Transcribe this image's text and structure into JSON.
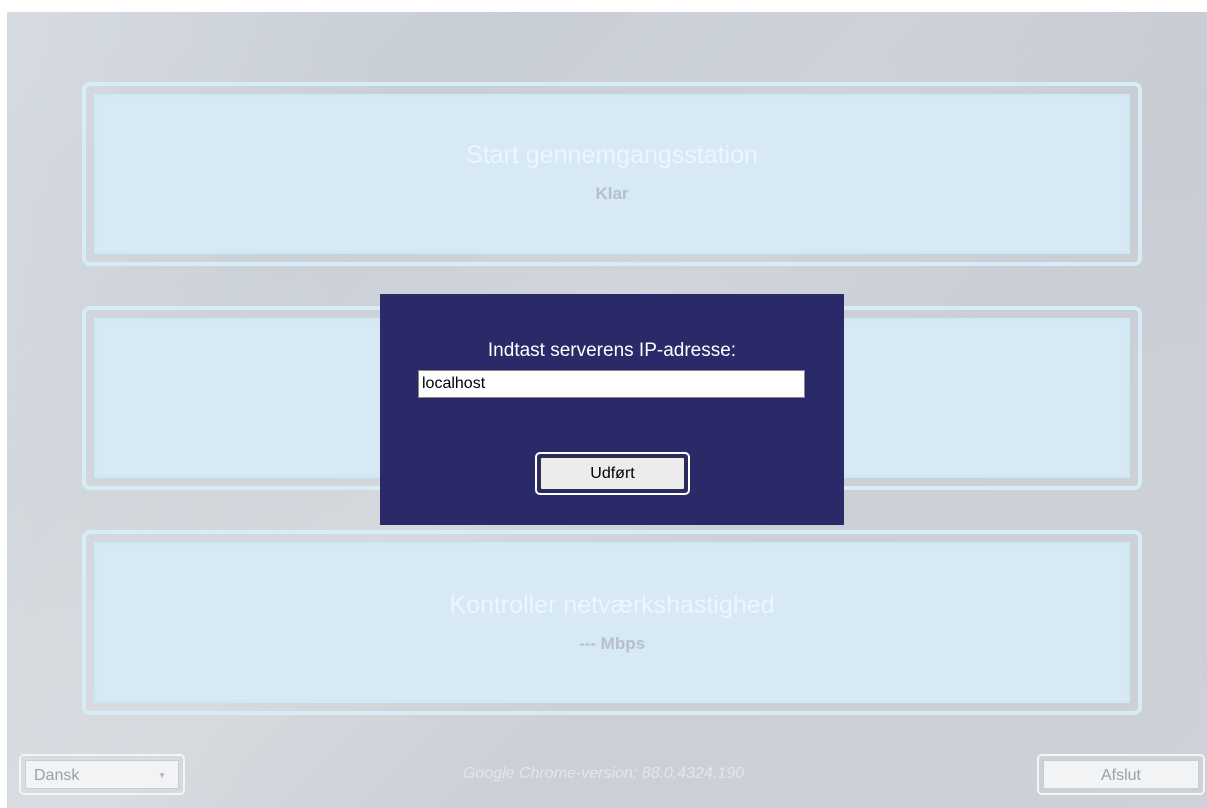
{
  "panels": {
    "start": {
      "title": "Start gennemgangsstation",
      "status": "Klar"
    },
    "middle": {
      "title": "",
      "status": ""
    },
    "network": {
      "title": "Kontroller netværkshastighed",
      "status": "--- Mbps"
    }
  },
  "dialog": {
    "label": "Indtast serverens IP-adresse:",
    "input_value": "localhost",
    "button_label": "Udført",
    "background_color": "#2b2a69"
  },
  "footer": {
    "language": "Dansk",
    "version_text": "Google Chrome-version:  88.0.4324.190",
    "exit_label": "Afslut"
  }
}
